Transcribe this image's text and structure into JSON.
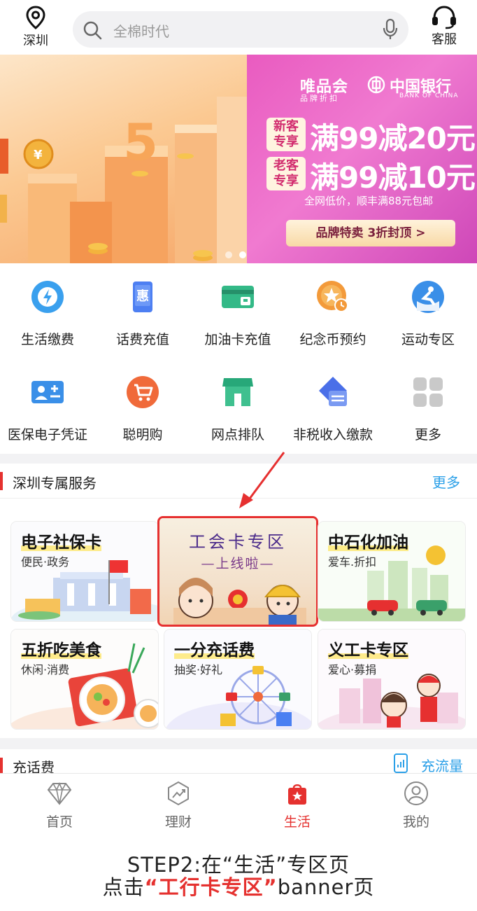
{
  "header": {
    "location": "深圳",
    "search_placeholder": "全棉时代",
    "service": "客服"
  },
  "banner": {
    "brand_name": "唯品会",
    "brand_sub": "品牌折扣",
    "bank_name": "中国银行",
    "bank_sub": "BANK OF CHINA",
    "deal_new_tag_line1": "新客",
    "deal_new_tag_line2": "专享",
    "deal_new": "满99减20元",
    "deal_old_tag_line1": "老客",
    "deal_old_tag_line2": "专享",
    "deal_old": "满99减10元",
    "note": "全网低价，顺丰满88元包邮",
    "cta": "品牌特卖 3折封顶 >",
    "left_number": "5",
    "left_coin": "¥",
    "slides_total": 2,
    "slide_active": 2
  },
  "grid": {
    "items": [
      {
        "label": "生活缴费",
        "icon": "lightning-icon"
      },
      {
        "label": "话费充值",
        "icon": "phone-hui-icon"
      },
      {
        "label": "加油卡充值",
        "icon": "fuel-card-icon"
      },
      {
        "label": "纪念币预约",
        "icon": "coin-star-icon"
      },
      {
        "label": "运动专区",
        "icon": "skating-icon"
      },
      {
        "label": "医保电子凭证",
        "icon": "medical-card-icon"
      },
      {
        "label": "聪明购",
        "icon": "cart-icon"
      },
      {
        "label": "网点排队",
        "icon": "branch-icon"
      },
      {
        "label": "非税收入缴款",
        "icon": "tax-icon"
      },
      {
        "label": "更多",
        "icon": "more-grid-icon"
      }
    ]
  },
  "section": {
    "title": "深圳专属服务",
    "more": "更多"
  },
  "cards": [
    {
      "title": "电子社保卡",
      "sub": "便民·政务"
    },
    {
      "title": "工会卡专区",
      "sub": "—上线啦—"
    },
    {
      "title": "中石化加油",
      "sub": "爱车.折扣"
    },
    {
      "title": "五折吃美食",
      "sub": "休闲·消费"
    },
    {
      "title": "一分充话费",
      "sub": "抽奖·好礼"
    },
    {
      "title": "义工卡专区",
      "sub": "爱心·募捐"
    }
  ],
  "charge": {
    "title": "充话费",
    "right": "充流量"
  },
  "tabs": [
    {
      "label": "首页",
      "icon": "diamond-icon"
    },
    {
      "label": "理财",
      "icon": "chart-up-icon"
    },
    {
      "label": "生活",
      "icon": "shopping-bag-star-icon"
    },
    {
      "label": "我的",
      "icon": "user-icon"
    }
  ],
  "active_tab": "生活",
  "caption": {
    "line1": "STEP2:在“生活”专区页",
    "line2_pre": "点击",
    "line2_highlight": "“工行卡专区”",
    "line2_post": "banner页"
  },
  "colors": {
    "accent_red": "#e5312f",
    "link_blue": "#2ba0e8"
  }
}
